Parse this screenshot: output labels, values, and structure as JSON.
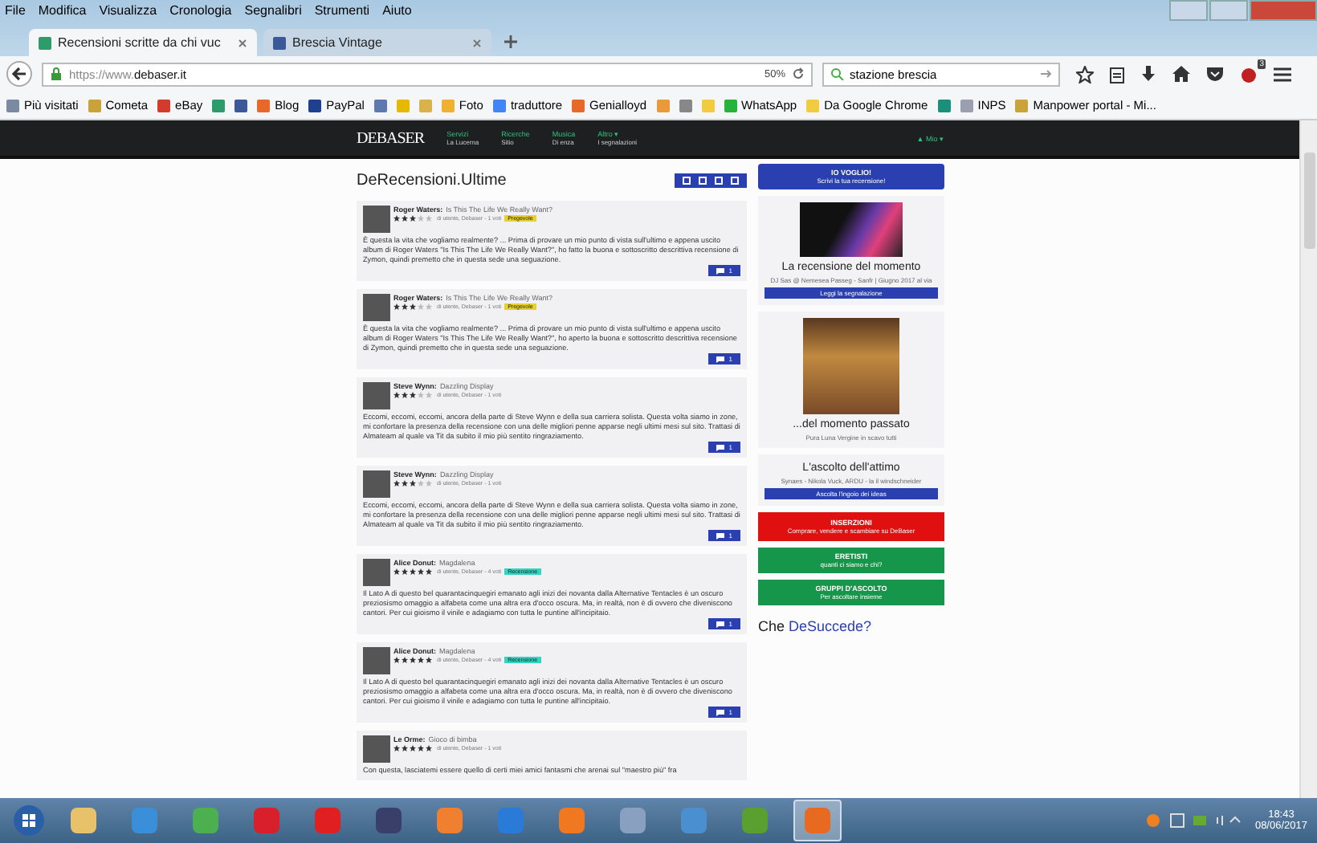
{
  "menu_bar": [
    "File",
    "Modifica",
    "Visualizza",
    "Cronologia",
    "Segnalibri",
    "Strumenti",
    "Aiuto"
  ],
  "tabs": [
    {
      "title": "Recensioni scritte da chi vuc",
      "selected": true,
      "color": "#2e9b6a"
    },
    {
      "title": "Brescia Vintage",
      "selected": false,
      "color": "#3b5998"
    }
  ],
  "toolbar": {
    "url_prefix": "https://www.",
    "url_domain": "debaser.it",
    "zoom": "50%",
    "search_value": "stazione brescia",
    "addon_badge": "3"
  },
  "bookmarks": [
    {
      "label": "Più visitati",
      "color": "#7a8aa0"
    },
    {
      "label": "Cometa",
      "color": "#c9a23a"
    },
    {
      "label": "eBay",
      "color": "#d33b2c"
    },
    {
      "color": "#2e9b6a"
    },
    {
      "color": "#3b5998"
    },
    {
      "label": "Blog",
      "color": "#e8682a"
    },
    {
      "label": "PayPal",
      "color": "#1f3f8f"
    },
    {
      "color": "#5d79b0"
    },
    {
      "color": "#e6b800"
    },
    {
      "color": "#d9b34a"
    },
    {
      "label": "Foto",
      "color": "#f0b030"
    },
    {
      "label": "traduttore",
      "color": "#4285f4"
    },
    {
      "label": "Genialloyd",
      "color": "#e8682a"
    },
    {
      "color": "#e89a3a"
    },
    {
      "color": "#888888"
    },
    {
      "color": "#f2cc40"
    },
    {
      "label": "WhatsApp",
      "color": "#25b33a"
    },
    {
      "label": "Da Google Chrome",
      "color": "#f2cc40"
    },
    {
      "color": "#1a8f7a"
    },
    {
      "label": "INPS",
      "color": "#9aa0b0"
    },
    {
      "label": "Manpower portal - Mi...",
      "color": "#c9a23a"
    }
  ],
  "site_nav": {
    "logo": "DEBASER",
    "items": [
      {
        "title": "Servizi",
        "sub": "La Lucerna"
      },
      {
        "title": "Ricerche",
        "sub": "Sitio"
      },
      {
        "title": "Musica",
        "sub": "Di enza"
      },
      {
        "title": "Altro ▾",
        "sub": "I segnalazioni"
      }
    ],
    "user": "▲ Mio ▾"
  },
  "main": {
    "title": "DeRecensioni.Ultime",
    "reviews": [
      {
        "author": "Roger Waters:",
        "title": "Is This The Life We Really Want?",
        "stars": 3,
        "meta": "di utente, Debaser - 1 voti",
        "tag": {
          "label": "Pregevole",
          "color": "#e6d22e"
        },
        "body": "È questa la vita che vogliamo realmente? ... Prima di provare un mio punto di vista sull'ultimo e appena uscito album di Roger Waters \"Is This The Life We Really Want?\", ho fatto la buona e sottoscritto descrittiva recensione di Zymon, quindi premetto che in questa sede una seguazione.",
        "comments": "1"
      },
      {
        "author": "Roger Waters:",
        "title": "Is This The Life We Really Want?",
        "stars": 3,
        "meta": "di utente, Debaser - 1 voti",
        "tag": {
          "label": "Pregevole",
          "color": "#e6d22e"
        },
        "body": "È questa la vita che vogliamo realmente? ... Prima di provare un mio punto di vista sull'ultimo e appena uscito album di Roger Waters \"Is This The Life We Really Want?\", ho aperto la buona e sottoscritto descrittiva recensione di Zymon, quindi premetto che in questa sede una seguazione.",
        "comments": "1"
      },
      {
        "author": "Steve Wynn:",
        "title": "Dazzling Display",
        "stars": 3,
        "meta": "di utente, Debaser - 1 voti",
        "body": "Eccomi, eccomi, eccomi, ancora della parte di Steve Wynn e della sua carriera solista. Questa volta siamo in zone, mi confortare la presenza della recensione con una delle migliori penne apparse negli ultimi mesi sul sito. Trattasi di Almateam al quale va Tit da subito il mio più sentito ringraziamento.",
        "comments": "1"
      },
      {
        "author": "Steve Wynn:",
        "title": "Dazzling Display",
        "stars": 3,
        "meta": "di utente, Debaser - 1 voti",
        "body": "Eccomi, eccomi, eccomi, ancora della parte di Steve Wynn e della sua carriera solista. Questa volta siamo in zone, mi confortare la presenza della recensione con una delle migliori penne apparse negli ultimi mesi sul sito. Trattasi di Almateam al quale va Tit da subito il mio più sentito ringraziamento.",
        "comments": "1"
      },
      {
        "author": "Alice Donut:",
        "title": "Magdalena",
        "stars": 5,
        "meta": "di utente, Debaser - 4 voti",
        "tag": {
          "label": "Recensione",
          "color": "#2fd6c0"
        },
        "body": "Il Lato A di questo bel quarantacinquegiri emanato agli inizi dei novanta dalla Alternative Tentacles è un oscuro preziosismo omaggio a alfabeta come una altra era d'occo oscura. Ma, in realtà, non è di ovvero che diveniscono cantori. Per cui gioismo il vinile e adagiamo con tutta le puntine all'incipitaio.",
        "comments": "1"
      },
      {
        "author": "Alice Donut:",
        "title": "Magdalena",
        "stars": 5,
        "meta": "di utente, Debaser - 4 voti",
        "tag": {
          "label": "Recensione",
          "color": "#2fd6c0"
        },
        "body": "Il Lato A di questo bel quarantacinquegiri emanato agli inizi dei novanta dalla Alternative Tentacles è un oscuro preziosismo omaggio a alfabeta come una altra era d'occo oscura. Ma, in realtà, non è di ovvero che diveniscono cantori. Per cui gioismo il vinile e adagiamo con tutta le puntine all'incipitaio.",
        "comments": "1"
      },
      {
        "author": "Le Orme:",
        "title": "Gioco di bimba",
        "stars": 5,
        "meta": "di utente, Debaser - 1 voti",
        "body": "Con questa, lasciatemi essere quello di certi miei amici fantasmi che arenai sul \"maestro più\" fra"
      }
    ]
  },
  "sidebar": {
    "cta": {
      "title": "IO VOGLIO!",
      "sub": "Scrivi la tua recensione!"
    },
    "featured": {
      "heading": "La recensione del momento",
      "caption": "DJ Sas @ Nemesea Passeg - Sanfr | Giugno 2017 al via",
      "button": "Leggi la segnalazione"
    },
    "past": {
      "heading": "...del momento passato",
      "caption": "Pura Luna Vergine in scavo tutti"
    },
    "listen": {
      "heading": "L'ascolto dell'attimo",
      "caption": "Synaes - Nikola Vuck, ARDU - la il windschneider",
      "button": "Ascolta l'ingoio dei ideas"
    },
    "ads": {
      "title": "INSERZIONI",
      "sub": "Comprare, vendere e scambiare su DeBaser"
    },
    "green_buttons": [
      {
        "title": "ERETISTI",
        "sub": "quanti ci siamo e chi?"
      },
      {
        "title": "GRUPPI D'ASCOLTO",
        "sub": "Per ascoltare insieme"
      }
    ],
    "bottom_heading_prefix": "Che ",
    "bottom_heading_accent": "DeSuccede?"
  },
  "taskbar": {
    "apps": [
      {
        "color": "#e8c26a",
        "selected": false
      },
      {
        "color": "#3a8fd8",
        "selected": false
      },
      {
        "color": "#4caf50",
        "selected": false
      },
      {
        "color": "#d8202a",
        "selected": false
      },
      {
        "color": "#e02020",
        "selected": false
      },
      {
        "color": "#3a3f6a",
        "selected": false
      },
      {
        "color": "#f08030",
        "selected": false
      },
      {
        "color": "#2a7ad8",
        "selected": false
      },
      {
        "color": "#f07820",
        "selected": false
      },
      {
        "color": "#8aa0c0",
        "selected": false
      },
      {
        "color": "#4a90d0",
        "selected": false
      },
      {
        "color": "#5aa030",
        "selected": false
      },
      {
        "color": "#e86a20",
        "selected": true
      }
    ],
    "time": "18:43",
    "date": "08/06/2017"
  }
}
